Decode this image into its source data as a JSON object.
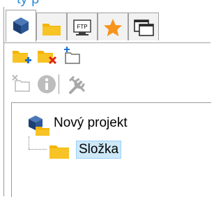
{
  "window": {
    "top_partial_text": "ty p"
  },
  "tabs": [
    {
      "name": "projects-tab",
      "icon": "cube-icon"
    },
    {
      "name": "folders-tab",
      "icon": "folder-icon"
    },
    {
      "name": "ftp-tab",
      "icon": "ftp-icon",
      "label": "FTP"
    },
    {
      "name": "favorites-tab",
      "icon": "star-icon"
    },
    {
      "name": "windows-tab",
      "icon": "windows-icon"
    }
  ],
  "toolbar_row1": [
    {
      "name": "add-folder-button",
      "icon": "folder-add-icon"
    },
    {
      "name": "delete-folder-button",
      "icon": "folder-delete-icon"
    },
    {
      "name": "new-item-button",
      "icon": "new-item-icon"
    }
  ],
  "toolbar_row2": [
    {
      "name": "remove-item-button",
      "icon": "remove-item-icon"
    },
    {
      "name": "info-button",
      "icon": "info-icon"
    },
    {
      "name": "settings-button",
      "icon": "tools-icon"
    }
  ],
  "tree": {
    "root_label": "Nový projekt",
    "child_label": "Složka"
  },
  "colors": {
    "folder": "#f4b400",
    "folder_dark": "#d99a00",
    "star": "#f7941d",
    "cube": "#1c3f73",
    "selection": "#cde8f7",
    "accent_blue": "#2a8fd8",
    "delete_red": "#e0251b",
    "add_blue": "#1d6fd1"
  }
}
